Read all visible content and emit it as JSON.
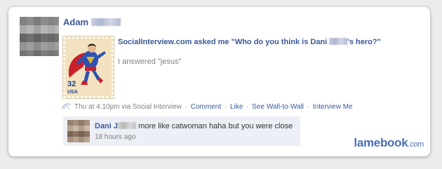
{
  "post": {
    "author_first": "Adam",
    "app_title": "SocialInterview.com asked me \"Who do you think is Dani ",
    "app_title_tail": "'s hero?\"",
    "answer": "I answered \"jesus\"",
    "stamp_value": "32",
    "stamp_country": "USA"
  },
  "meta": {
    "time": "Thu at 4:10pm via Social Interview",
    "comment_link": "Comment",
    "like_link": "Like",
    "wall_link": "See Wall-to-Wall",
    "interview_link": "Interview Me",
    "separator": "·"
  },
  "comment": {
    "author_first": "Dani J",
    "text": "more like catwoman haha but you were close",
    "time": "18 hours ago"
  },
  "watermark": {
    "brand": "lamebook",
    "tld": ".com"
  },
  "colors": {
    "link": "#3b5998",
    "meta_gray": "#808080",
    "comment_bg": "#eceff5",
    "watermark": "#4a6fb5"
  },
  "icons": [
    "app-icon"
  ]
}
